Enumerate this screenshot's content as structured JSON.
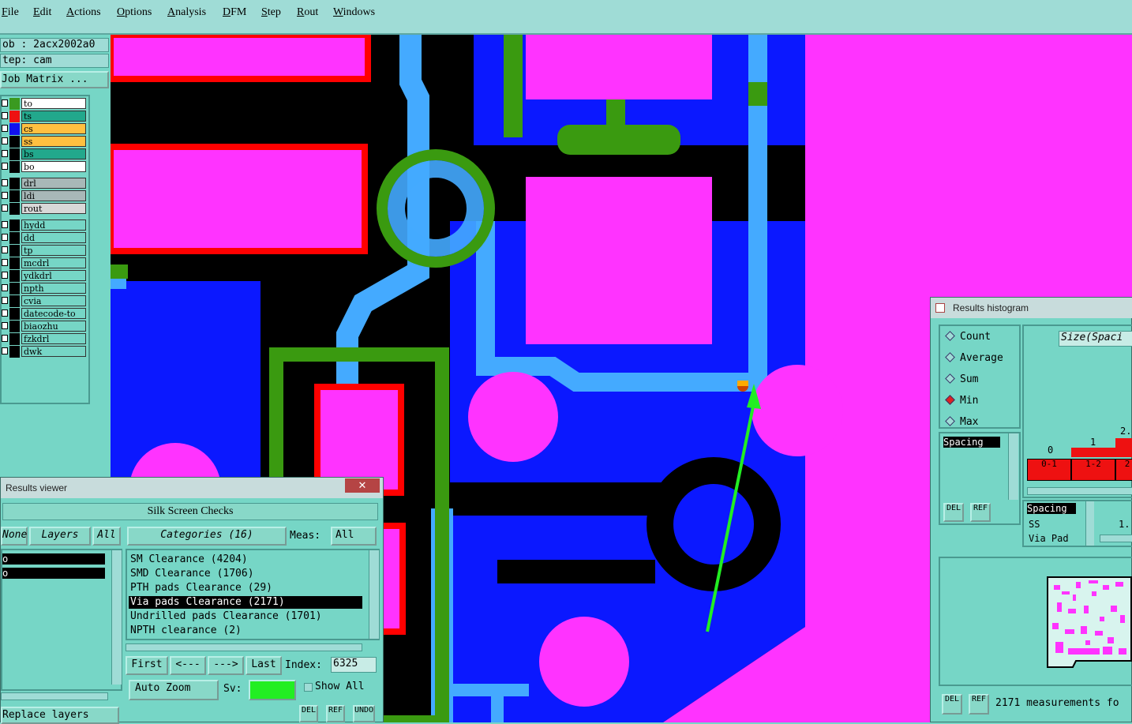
{
  "menu": [
    "File",
    "Edit",
    "Actions",
    "Options",
    "Analysis",
    "DFM",
    "Step",
    "Rout",
    "Windows"
  ],
  "job": {
    "job_line": "ob  : 2acx2002a0",
    "step_line": "tep: cam",
    "matrix_button": "Job Matrix ..."
  },
  "layers": {
    "board": [
      {
        "name": "to",
        "color": "#3a9a20",
        "bg": "#ffffff"
      },
      {
        "name": "ts",
        "color": "#ee1111",
        "bg": "#22a88c"
      },
      {
        "name": "cs",
        "color": "#1111ee",
        "bg": "#ffc040"
      },
      {
        "name": "ss",
        "color": "#000000",
        "bg": "#ffc040"
      },
      {
        "name": "bs",
        "color": "#000000",
        "bg": "#22a88c"
      },
      {
        "name": "bo",
        "color": "#000000",
        "bg": "#ffffff"
      }
    ],
    "drill": [
      {
        "name": "drl",
        "color": "#000000",
        "bg": "#a8b8b8"
      },
      {
        "name": "ldi",
        "color": "#000000",
        "bg": "#a8b8b8"
      },
      {
        "name": "rout",
        "color": "#000000",
        "bg": "#d8d8d8"
      }
    ],
    "misc": [
      "hydd",
      "dd",
      "tp",
      "mcdrl",
      "ydkdrl",
      "npth",
      "cvia",
      "datecode-to",
      "biaozhu",
      "fzkdrl",
      "dwk"
    ]
  },
  "results_viewer": {
    "title": "Results viewer",
    "close_glyph": "✕",
    "header": "Silk Screen Checks",
    "none_btn": "None",
    "layers_btn": "Layers",
    "all_btn": "All",
    "categories_btn": "Categories (16)",
    "meas_label": "Meas:",
    "meas_value": "All",
    "layer_items": [
      "o",
      "o"
    ],
    "categories": [
      {
        "label": "SM Clearance (4204)",
        "selected": false
      },
      {
        "label": "SMD Clearance (1706)",
        "selected": false
      },
      {
        "label": "PTH pads Clearance (29)",
        "selected": false
      },
      {
        "label": "Via pads Clearance (2171)",
        "selected": true
      },
      {
        "label": "Undrilled pads Clearance (1701)",
        "selected": false
      },
      {
        "label": "NPTH clearance (2)",
        "selected": false
      }
    ],
    "first_btn": "First",
    "prev_btn": "<---",
    "next_btn": "--->",
    "last_btn": "Last",
    "index_label": "Index:",
    "index_value": "6325",
    "auto_zoom": "Auto Zoom",
    "sv_label": "Sv:",
    "show_all": "Show All",
    "replace_layers": "Replace layers",
    "del": "DEL",
    "ref": "REF",
    "undo": "UNDO"
  },
  "histogram": {
    "title": "Results histogram",
    "options": [
      {
        "label": "Count",
        "selected": false
      },
      {
        "label": "Average",
        "selected": false
      },
      {
        "label": "Sum",
        "selected": false
      },
      {
        "label": "Min",
        "selected": true
      },
      {
        "label": "Max",
        "selected": false
      }
    ],
    "size_header": "Size(Spaci",
    "spacing_item": "Spacing",
    "bin_labels_top": [
      "0",
      "1",
      "2."
    ],
    "bin_labels_bottom": [
      "0-1",
      "1-2",
      "2"
    ],
    "detail_lines": [
      "Spacing",
      "SS",
      "Via Pad"
    ],
    "detail_value": "1.",
    "footer": "2171 measurements fo",
    "del": "DEL",
    "ref": "REF"
  },
  "colors": {
    "magenta": "#ff33ff",
    "blue": "#0b18ff",
    "light_blue": "#44aaff",
    "green": "#3a9a10",
    "red": "#ff0000",
    "arrow": "#22ee22",
    "teal": "#76d6c6"
  }
}
